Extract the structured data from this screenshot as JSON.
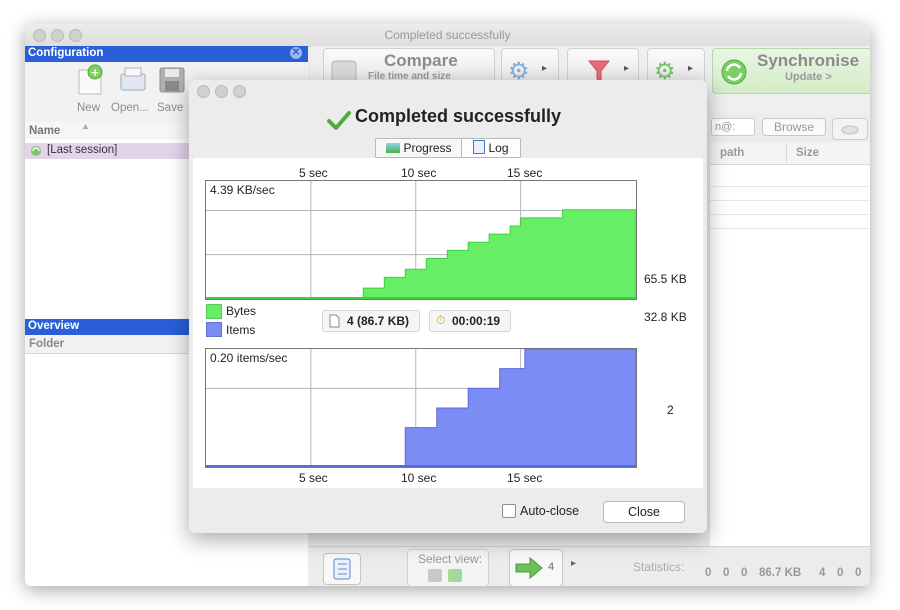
{
  "main_window": {
    "title": "Completed successfully"
  },
  "configuration": {
    "title": "Configuration",
    "toolbar": {
      "new_label": "New",
      "open_label": "Open...",
      "save_label": "Save"
    },
    "name_header": "Name",
    "items": [
      "[Last session]"
    ]
  },
  "overview": {
    "title": "Overview",
    "folder_header": "Folder"
  },
  "toolbar": {
    "compare_label": "Compare",
    "compare_sub": "File time and size",
    "sync_label": "Synchronise",
    "sync_sub": "Update >"
  },
  "folder_pane": {
    "browse_label": "Browse",
    "path_header": "path",
    "size_header": "Size",
    "field_text": "n@:"
  },
  "bottom_bar": {
    "select_view_label": "Select view:",
    "count_badge": "4",
    "statistics_label": "Statistics:",
    "stats": [
      "0",
      "0",
      "0",
      "86.7 KB",
      "4",
      "0",
      "0"
    ]
  },
  "dialog": {
    "title": "Completed successfully",
    "tabs": [
      "Progress",
      "Log"
    ],
    "top_ticks": [
      "5 sec",
      "10 sec",
      "15 sec"
    ],
    "bottom_ticks": [
      "5 sec",
      "10 sec",
      "15 sec"
    ],
    "bytes_rate": "4.39 KB/sec",
    "bytes_axis": [
      "65.5 KB",
      "32.8 KB"
    ],
    "items_rate": "0.20 items/sec",
    "items_axis": [
      "2"
    ],
    "legend": [
      {
        "label": "Bytes",
        "color": "#66ee66"
      },
      {
        "label": "Items",
        "color": "#7b8cf5"
      }
    ],
    "summary_items": "4 (86.7 KB)",
    "summary_time": "00:00:19",
    "autoclose_label": "Auto-close",
    "close_label": "Close"
  },
  "colors": {
    "accent_blue": "#2a5fd8",
    "bytes_green": "#66ee66",
    "items_blue": "#7b8cf5",
    "session_pink": "#e4d4ea"
  },
  "chart_data": [
    {
      "type": "area",
      "series": [
        {
          "name": "Bytes",
          "unit": "KB",
          "x": [
            0,
            7.5,
            8.5,
            9.5,
            10.5,
            11.5,
            12.5,
            13.5,
            14.5,
            15,
            17,
            20.5
          ],
          "values": [
            0,
            8,
            16,
            22,
            30,
            36,
            42,
            48,
            54,
            60,
            66,
            66
          ]
        }
      ],
      "xticks": [
        "5 sec",
        "10 sec",
        "15 sec"
      ],
      "xlim": [
        0,
        20.5
      ],
      "ylim": [
        0,
        87.3
      ],
      "yticks": [
        "65.5 KB",
        "32.8 KB"
      ],
      "annotation": "4.39 KB/sec",
      "grid": true
    },
    {
      "type": "area",
      "series": [
        {
          "name": "Items",
          "x": [
            0,
            9.5,
            11,
            12.5,
            14,
            15.2,
            20.5
          ],
          "values": [
            0,
            1,
            1.5,
            2,
            2.5,
            3,
            3
          ]
        }
      ],
      "xticks": [
        "5 sec",
        "10 sec",
        "15 sec"
      ],
      "xlim": [
        0,
        20.5
      ],
      "ylim": [
        0,
        3
      ],
      "yticks": [
        "2"
      ],
      "annotation": "0.20 items/sec",
      "grid": true
    }
  ]
}
